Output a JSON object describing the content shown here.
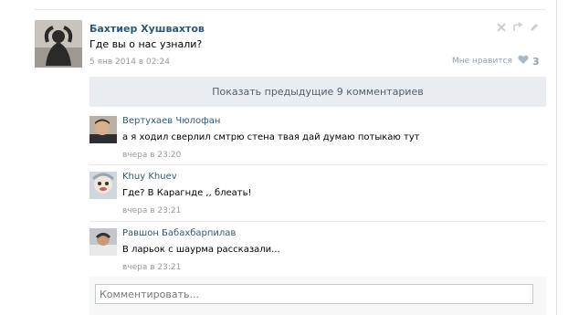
{
  "post": {
    "author": "Бахтиер Хушвахтов",
    "text": "Где вы о нас узнали?",
    "date": "5 янв 2014 в 02:24",
    "like_label": "Мне нравится",
    "like_count": "3"
  },
  "show_previous_label": "Показать предыдущие 9 комментариев",
  "replies": [
    {
      "author": "Вертухаев Чюлофан",
      "text": "а я ходил сверлил смтрю стена твая дай думаю потыкаю тут",
      "date": "вчера в 23:20"
    },
    {
      "author": "Khuy Khuev",
      "text": "Где? В Карагнде ,, блеать!",
      "date": "вчера в 23:21"
    },
    {
      "author": "Равшон Бабахбарпилав",
      "text": "В ларьок с шаурма рассказали...",
      "date": "вчера в 23:21"
    }
  ],
  "comment_input": {
    "placeholder": "Комментировать..."
  },
  "colors": {
    "link": "#2b587a",
    "muted": "#999999",
    "like": "#8fa1b3",
    "bar": "#e9edf1"
  },
  "icons": [
    "delete-icon",
    "share-icon",
    "edit-icon",
    "heart-icon"
  ]
}
